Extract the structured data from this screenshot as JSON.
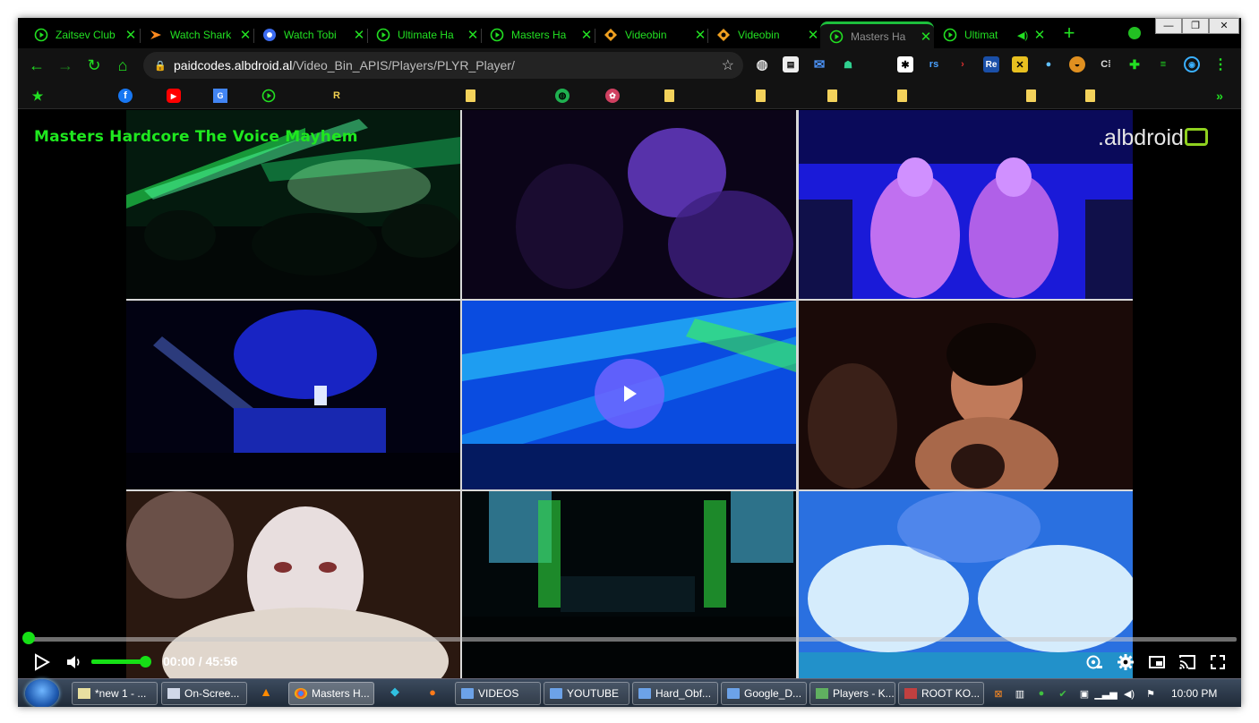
{
  "browser": {
    "tabs": [
      {
        "title": "Zaitsev Club",
        "icon": "play-circle-icon"
      },
      {
        "title": "Watch Shark",
        "icon": "lightning-icon"
      },
      {
        "title": "Watch Tobi",
        "icon": "circle-logo-icon"
      },
      {
        "title": "Ultimate Ha",
        "icon": "play-circle-icon"
      },
      {
        "title": "Masters Ha",
        "icon": "play-circle-icon"
      },
      {
        "title": "Videobin",
        "icon": "diamond-icon"
      },
      {
        "title": "Videobin",
        "icon": "diamond-icon"
      },
      {
        "title": "Masters Ha",
        "icon": "play-circle-icon",
        "active": true
      },
      {
        "title": "Ultimat",
        "icon": "play-circle-icon",
        "audio": true
      }
    ],
    "url_host": "paidcodes.albdroid.al",
    "url_path": "/Video_Bin_APIS/Players/PLYR_Player/",
    "window_buttons": {
      "minimize": "—",
      "maximize": "❐",
      "close": "✕"
    }
  },
  "player": {
    "title": "Masters Hardcore The Voice Mayhem",
    "watermark": ".albdroid",
    "time_current": "00:00",
    "time_separator": "/",
    "time_total": "45:56",
    "progress": 0.0,
    "volume": 1.0,
    "accent_color": "#16e016"
  },
  "taskbar": {
    "items": [
      {
        "label": "*new 1 - ...",
        "icon": "notepad-icon"
      },
      {
        "label": "On-Scree...",
        "icon": "keyboard-icon"
      },
      {
        "label": "Masters H...",
        "icon": "chrome-icon",
        "active": true
      },
      {
        "label": "VIDEOS",
        "icon": "folder-icon"
      },
      {
        "label": "YOUTUBE",
        "icon": "folder-icon"
      },
      {
        "label": "Hard_Obf...",
        "icon": "folder-icon"
      },
      {
        "label": "Google_D...",
        "icon": "folder-icon"
      },
      {
        "label": "Players - K...",
        "icon": "app-icon"
      },
      {
        "label": "ROOT KO...",
        "icon": "app-icon"
      }
    ],
    "clock": "10:00 PM"
  }
}
